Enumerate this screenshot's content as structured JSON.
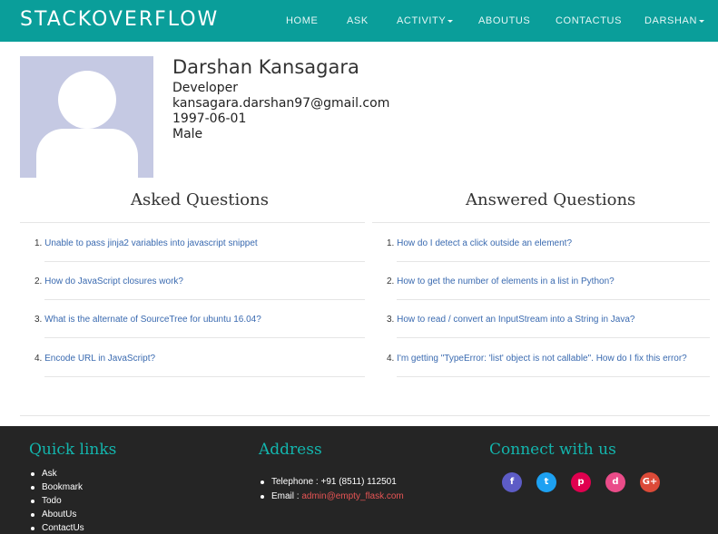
{
  "brand": "STACKOVERFLOW",
  "nav": {
    "home": "HOME",
    "ask": "ASK",
    "activity": "ACTIVITY",
    "aboutus": "ABOUTUS",
    "contactus": "CONTACTUS",
    "user": "DARSHAN"
  },
  "profile": {
    "name": "Darshan Kansagara",
    "role": "Developer",
    "email": "kansagara.darshan97@gmail.com",
    "dob": "1997-06-01",
    "gender": "Male"
  },
  "asked": {
    "title": "Asked Questions",
    "items": [
      {
        "num": "1.",
        "text": "Unable to pass jinja2 variables into javascript snippet"
      },
      {
        "num": "2.",
        "text": "How do JavaScript closures work?"
      },
      {
        "num": "3.",
        "text": "What is the alternate of SourceTree for ubuntu 16.04?"
      },
      {
        "num": "4.",
        "text": "Encode URL in JavaScript?"
      }
    ]
  },
  "answered": {
    "title": "Answered Questions",
    "items": [
      {
        "num": "1.",
        "text": "How do I detect a click outside an element?"
      },
      {
        "num": "2.",
        "text": "How to get the number of elements in a list in Python?"
      },
      {
        "num": "3.",
        "text": "How to read / convert an InputStream into a String in Java?"
      },
      {
        "num": "4.",
        "text": "I'm getting \"TypeError: 'list' object is not callable\". How do I fix this error?"
      }
    ]
  },
  "footer": {
    "quick_links": {
      "title": "Quick links",
      "items": [
        "Ask",
        "Bookmark",
        "Todo",
        "AboutUs",
        "ContactUs"
      ]
    },
    "address": {
      "title": "Address",
      "telephone": "Telephone : +91 (8511) 112501",
      "email_label": "Email : ",
      "email": "admin@empty_flask.com"
    },
    "connect": {
      "title": "Connect with us",
      "icons": [
        {
          "name": "facebook-icon",
          "glyph": "f",
          "color": "#5d5cc6"
        },
        {
          "name": "twitter-icon",
          "glyph": "t",
          "color": "#1da1f2"
        },
        {
          "name": "pinterest-icon",
          "glyph": "p",
          "color": "#e0004f"
        },
        {
          "name": "dribbble-icon",
          "glyph": "d",
          "color": "#ea4c89"
        },
        {
          "name": "google-plus-icon",
          "glyph": "G+",
          "color": "#dc4a38"
        }
      ]
    }
  },
  "colors": {
    "navbar": "#0a9e9a",
    "footer": "#252525",
    "accent": "#13b5ad",
    "link": "#3a6ab0",
    "email_link": "#e85555"
  }
}
